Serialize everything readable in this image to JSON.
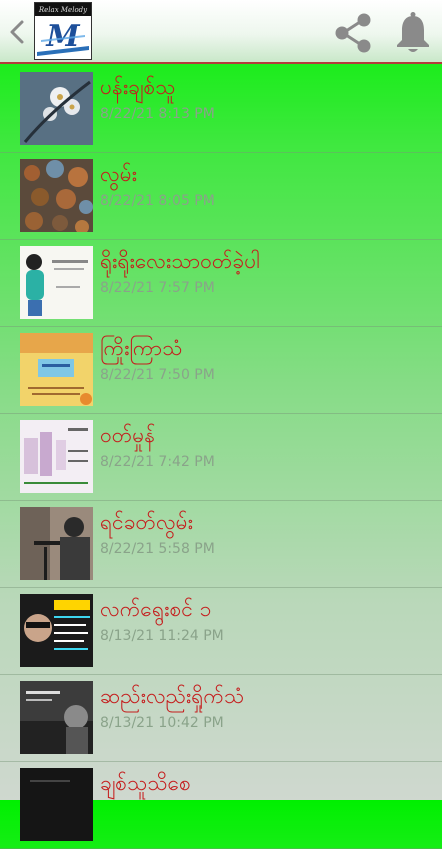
{
  "header": {
    "logo_caption": "Relax Melody",
    "logo_letter": "M",
    "icons": {
      "back": "chevron-left-icon",
      "share": "share-icon",
      "notification": "bell-icon"
    },
    "colors": {
      "accent_line": "#b43a3a",
      "icon": "#8a8a8a"
    }
  },
  "list": {
    "items": [
      {
        "title": "ပန်းချစ်သူ",
        "date": "8/22/21 8:13 PM",
        "thumb": "blossom-photo"
      },
      {
        "title": "လွမ်း",
        "date": "8/22/21 8:05 PM",
        "thumb": "autumn-leaves-photo"
      },
      {
        "title": "ရိုးရိုးလေးသာဝတ်ခဲ့ပါ",
        "date": "8/22/21 7:57 PM",
        "thumb": "woman-illustration"
      },
      {
        "title": "ကြိုးကြာသံ",
        "date": "8/22/21 7:50 PM",
        "thumb": "yellow-poster"
      },
      {
        "title": "ဝတ်မှုန်",
        "date": "8/22/21 7:42 PM",
        "thumb": "pink-poster"
      },
      {
        "title": "ရင်ခတ်လွမ်း",
        "date": "8/22/21 5:58 PM",
        "thumb": "singer-microphone-photo"
      },
      {
        "title": "လက်ရွေးစင် ၁",
        "date": "8/13/21 11:24 PM",
        "thumb": "album-cover-dark"
      },
      {
        "title": "ဆည်းလည်းရှိုက်သံ",
        "date": "8/13/21 10:42 PM",
        "thumb": "dark-album-cover"
      },
      {
        "title": "ချစ်သူသိစေ",
        "date": "",
        "thumb": "dark-cover"
      }
    ],
    "colors": {
      "title": "#c51d1d",
      "date": "#8aa38a"
    }
  }
}
